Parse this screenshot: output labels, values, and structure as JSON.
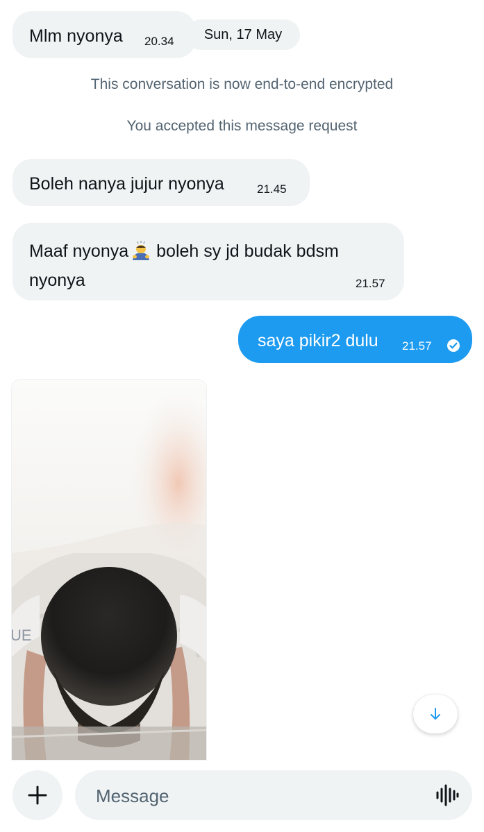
{
  "messages": [
    {
      "text": "Mlm nyonya",
      "time": "20.34",
      "direction": "incoming"
    },
    {
      "text": "Boleh nanya jujur nyonya",
      "time": "21.45",
      "direction": "incoming"
    },
    {
      "text_before_emoji": "Maaf nyonya",
      "emoji": "person-bowing-emoji",
      "text_after_emoji": "boleh sy jd budak bdsm nyonya",
      "time": "21.57",
      "direction": "incoming"
    },
    {
      "text": "saya pikir2 dulu",
      "time": "21.57",
      "direction": "outgoing",
      "status_icon": "read-check-icon"
    }
  ],
  "date_divider": "Sun, 17 May",
  "system_notices": {
    "encrypted": "This conversation is now end-to-end encrypted",
    "accepted": "You accepted this message request"
  },
  "attachment": {
    "type": "photo"
  },
  "scroll_button": {
    "icon": "arrow-down-icon"
  },
  "composer": {
    "add_icon": "plus-icon",
    "placeholder": "Message",
    "voice_icon": "voice-waveform-icon"
  },
  "colors": {
    "accent": "#1d9bf0",
    "incoming_bubble": "#eff3f4",
    "system_text": "#536471",
    "primary_text": "#0f1419"
  }
}
